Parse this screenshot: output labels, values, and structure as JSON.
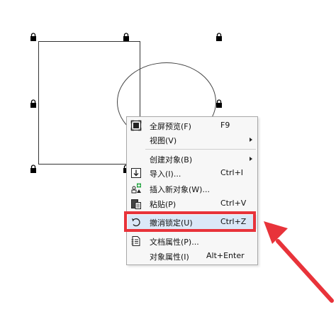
{
  "canvas": {
    "handle_color": "#000000",
    "shape_stroke": "#333333"
  },
  "context_menu": {
    "items": [
      {
        "label": "全屏预览(F)",
        "shortcut": "F9",
        "icon": "fullscreen-preview-icon"
      },
      {
        "label": "视图(V)",
        "submenu": true
      },
      {
        "label": "创建对象(B)",
        "submenu": true
      },
      {
        "label": "导入(I)...",
        "shortcut": "Ctrl+I",
        "icon": "import-icon"
      },
      {
        "label": "插入新对象(W)...",
        "icon": "insert-object-icon"
      },
      {
        "label": "粘贴(P)",
        "shortcut": "Ctrl+V",
        "icon": "paste-icon"
      },
      {
        "label": "撤消锁定(U)",
        "shortcut": "Ctrl+Z",
        "icon": "undo-icon",
        "highlighted": true
      },
      {
        "label": "文档属性(P)...",
        "icon": "document-properties-icon"
      },
      {
        "label": "对象属性(I)",
        "shortcut": "Alt+Enter"
      }
    ]
  },
  "annotation": {
    "highlight_color": "#e8333a",
    "arrow_color": "#e8333a"
  }
}
